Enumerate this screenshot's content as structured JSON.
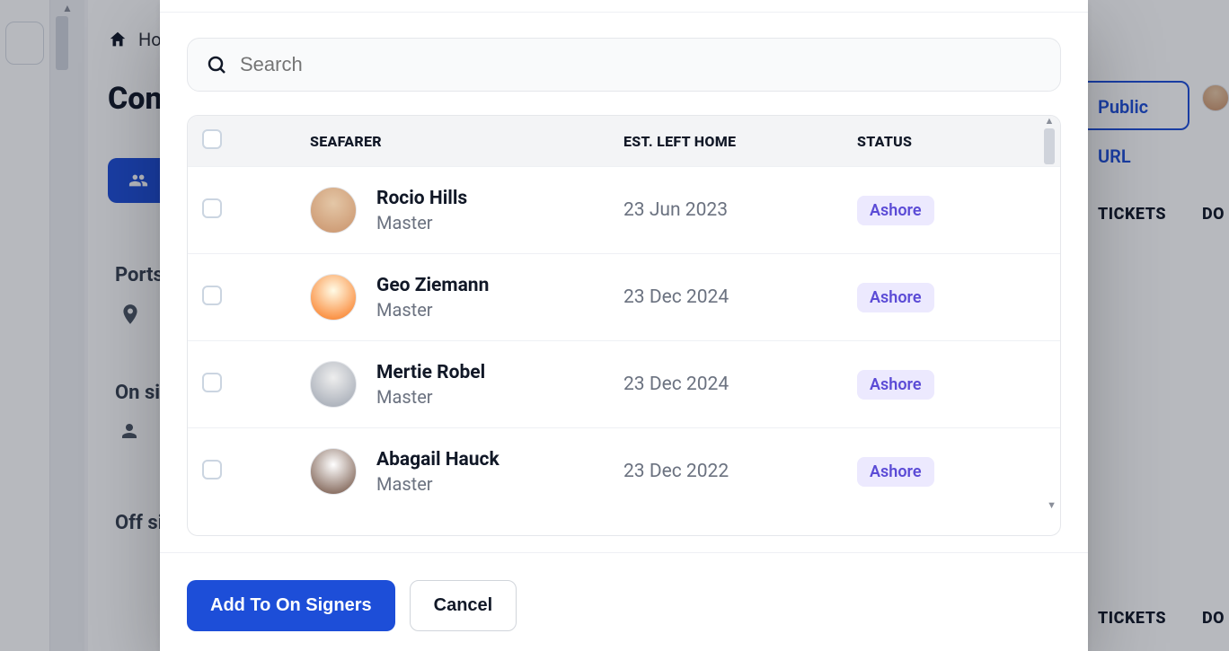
{
  "background": {
    "breadcrumb_home": "Home",
    "page_title_partial": "Con",
    "sections": {
      "ports": "Ports",
      "on_signers": "On sig",
      "off_signers": "Off sig"
    },
    "right_button": "Public URL",
    "columns": {
      "tickets": "TICKETS",
      "documents_partial": "DO"
    }
  },
  "modal": {
    "search_placeholder": "Search",
    "columns": {
      "seafarer": "SEAFARER",
      "est_left_home": "EST. LEFT HOME",
      "status": "STATUS"
    },
    "rows": [
      {
        "name": "Rocio Hills",
        "role": "Master",
        "date": "23 Jun 2023",
        "status": "Ashore",
        "avatar_variant": ""
      },
      {
        "name": "Geo Ziemann",
        "role": "Master",
        "date": "23 Dec 2024",
        "status": "Ashore",
        "avatar_variant": "v2"
      },
      {
        "name": "Mertie Robel",
        "role": "Master",
        "date": "23 Dec 2024",
        "status": "Ashore",
        "avatar_variant": "v3"
      },
      {
        "name": "Abagail Hauck",
        "role": "Master",
        "date": "23 Dec 2022",
        "status": "Ashore",
        "avatar_variant": "v4"
      }
    ],
    "footer": {
      "primary": "Add To On Signers",
      "secondary": "Cancel"
    }
  }
}
